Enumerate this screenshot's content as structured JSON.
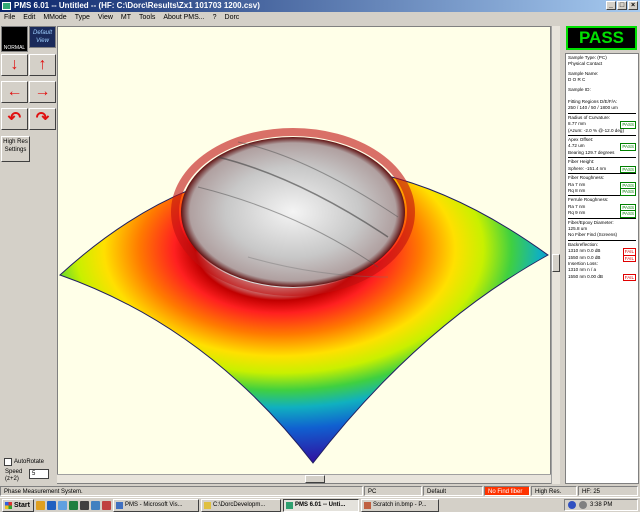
{
  "window": {
    "title": "PMS 6.01 -- Untitled --  (HF: C:\\Dorc\\Results\\Zx1 101703 1200.csv)",
    "controls": [
      "_",
      "□",
      "×"
    ]
  },
  "menu": [
    "File",
    "Edit",
    "MMode",
    "Type",
    "View",
    "MT",
    "Tools",
    "About PMS...",
    "?",
    "Dorc"
  ],
  "left_panel": {
    "normal_label": "NORMAL",
    "default_view_label": "Default View",
    "arrows": [
      "↓",
      "↑",
      "←",
      "→",
      "↶",
      "↷"
    ],
    "hires_label": "High Res Settings",
    "autorotate_label": "AutoRotate",
    "speed_label": "Speed (z+2)",
    "speed_value": "5"
  },
  "result": {
    "overall": "PASS",
    "sample_type_label": "Sample Type: (PC)",
    "sample_type_value": "Physical Contact",
    "sample_name_label": "Sample Name:",
    "sample_name_value": "D O R C",
    "sample_id_label": "Sample ID:",
    "fitting_label": "Fitting Regions D/E/F/A:",
    "fitting_value": "250 / 140 / 50 / 1800 um",
    "radius_label": "Radius of Curvature:",
    "radius_value": "8.77 mm",
    "radius_status": "PASS",
    "azimuth_value": "(Azum: -2.0 % @-12.0 deg)",
    "apex_label": "Apex Offset:",
    "apex_value": "4.72 um",
    "apex_status": "PASS",
    "bearing_value": "Bearing 129.7 degrees",
    "fiber_height_label": "Fiber Height:",
    "fiber_height_value": "Sphere: -151.4 nm",
    "fiber_height_status": "PASS",
    "fiber_rough_label": "Fiber Roughness:",
    "fiber_ra": "Ra        7 nm",
    "fiber_ra_status": "PASS",
    "fiber_rq": "Rq        8 nm",
    "fiber_rq_status": "PASS",
    "ferrule_rough_label": "Ferrule Roughness:",
    "ferrule_ra": "Ra        7 nm",
    "ferrule_ra_status": "PASS",
    "ferrule_rq": "Rq        9 nm",
    "ferrule_rq_status": "PASS",
    "epoxy_label": "Fiber/Epoxy Diameter:",
    "epoxy_value": "125.8 um",
    "epoxy_note": "No Fiber Find (Screens)",
    "backreflection_label": "Backreflection:",
    "br_1310": "1310 nm      0.0 dB",
    "br_1310_status": "FAIL",
    "br_1550": "1550 nm      0.0 dB",
    "br_1550_status": "FAIL",
    "insertion_label": "Insertion Loss:",
    "il_1310": "1310 nm      n / a",
    "il_1550": "1550 nm     0.00 dB",
    "il_1550_status": "FAIL"
  },
  "status_bar": {
    "message": "Phase Measurement System.",
    "type": "PC",
    "mode": "Default",
    "fiber_find": "No Find fiber",
    "resolution": "High Res.",
    "hf": "HF: 25"
  },
  "taskbar": {
    "start": "Start",
    "tasks": [
      "PMS - Microsoft Vis...",
      "C:\\DorcDevelopm...",
      "PMS 6.01 -- Unti...",
      "Scratch in.bmp - P..."
    ],
    "time": "3:38 PM"
  },
  "colors": {
    "title_gradient_start": "#0a246a",
    "title_gradient_end": "#a6caf0",
    "pass_green": "#00e000",
    "fail_red": "#e00000",
    "no_fiber_red": "#ff3300"
  }
}
